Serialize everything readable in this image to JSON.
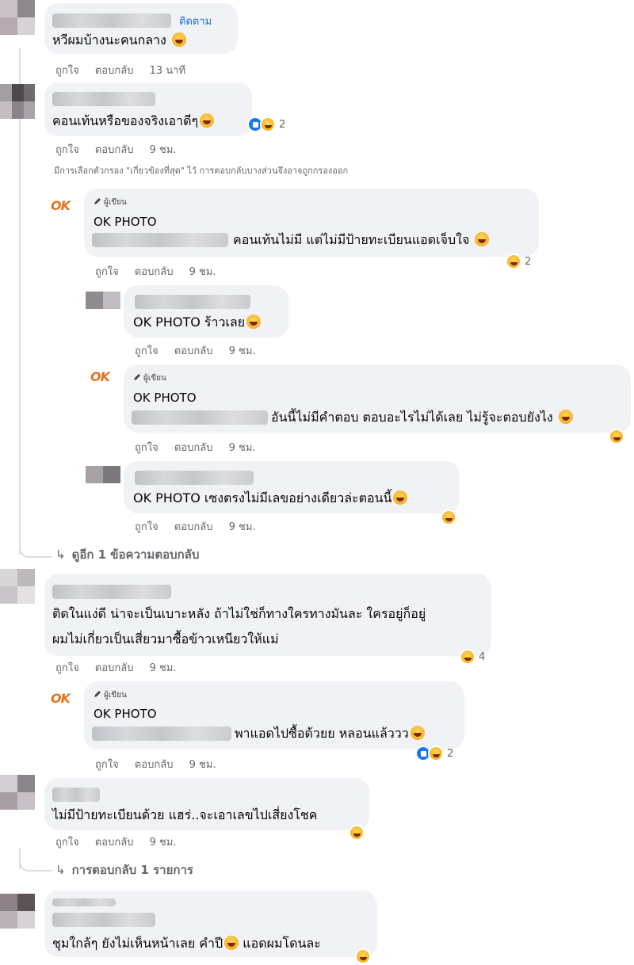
{
  "comments": {
    "c1": {
      "text": "หวีผมบ้างนะคนกลาง",
      "follow": "ติดตาม",
      "like": "ถูกใจ",
      "reply": "ตอบกลับ",
      "time": "13 นาที"
    },
    "c2": {
      "text": "คอนเท้นหรือของจริงเอาดีๆ",
      "like": "ถูกใจ",
      "reply": "ตอบกลับ",
      "time": "9 ชม.",
      "reactions": "2"
    },
    "notice": "มีการเลือกตัวกรอง \"เกี่ยวข้องที่สุด\" ไว้ การตอบกลับบางส่วนจึงอาจถูกกรองออก",
    "r1": {
      "author_badge": "ผู้เขียน",
      "page": "OK PHOTO",
      "text": "คอนเท้นไม่มี แต่ไม่มีป้ายทะเบียนแอดเจ็บใจ",
      "like": "ถูกใจ",
      "reply": "ตอบกลับ",
      "time": "9 ชม.",
      "reactions": "2"
    },
    "r2": {
      "text": "OK PHOTO ร้าวเลย",
      "like": "ถูกใจ",
      "reply": "ตอบกลับ",
      "time": "9 ชม."
    },
    "r3": {
      "author_badge": "ผู้เขียน",
      "page": "OK PHOTO",
      "text": "อันนี้ไม่มีคำตอบ ตอบอะไรไม่ได้เลย ไม่รู้จะตอบยังไง",
      "like": "ถูกใจ",
      "reply": "ตอบกลับ",
      "time": "9 ชม."
    },
    "r4": {
      "text": "OK PHOTO เซงตรงไม่มีเลขอย่างเดียวล่ะตอนนี้",
      "like": "ถูกใจ",
      "reply": "ตอบกลับ",
      "time": "9 ชม."
    },
    "more1": "ดูอีก 1 ข้อความตอบกลับ",
    "c3": {
      "line1": "ติดในแง่ดี น่าจะเป็นเบาะหลัง ถ้าไม่ใช่ก็ทางใครทางมันละ ใครอยู่ก็อยู่",
      "line2": "ผมไม่เกี่ยวเป็นเสี่ยวมาซื้อข้าวเหนียวให้แม่",
      "like": "ถูกใจ",
      "reply": "ตอบกลับ",
      "time": "9 ชม.",
      "reactions": "4"
    },
    "r5": {
      "author_badge": "ผู้เขียน",
      "page": "OK PHOTO",
      "text": "พาแอดไปซื้อด้วยย หลอนแล้ววว",
      "like": "ถูกใจ",
      "reply": "ตอบกลับ",
      "time": "9 ชม.",
      "reactions": "2"
    },
    "c4": {
      "text": "ไม่มีป้ายทะเบียนด้วย แฮร่..จะเอาเลขไปเสี่ยงโชค",
      "like": "ถูกใจ",
      "reply": "ตอบกลับ",
      "time": "9 ชม."
    },
    "more2": "การตอบกลับ 1 รายการ",
    "c5": {
      "text": "ชุมใกล้ๆ ยังไม่เห็นหน้าเลย คำปี",
      "text2": "แอดผมโดนละ"
    }
  },
  "colors": {
    "bubble": "#f0f2f5",
    "meta": "#65676b",
    "link": "#216fdb",
    "logo": "#e8731a"
  },
  "icons": {
    "reply_arrow": "↳",
    "pen": "pencil-icon",
    "like": "like-icon",
    "haha": "haha-icon"
  }
}
